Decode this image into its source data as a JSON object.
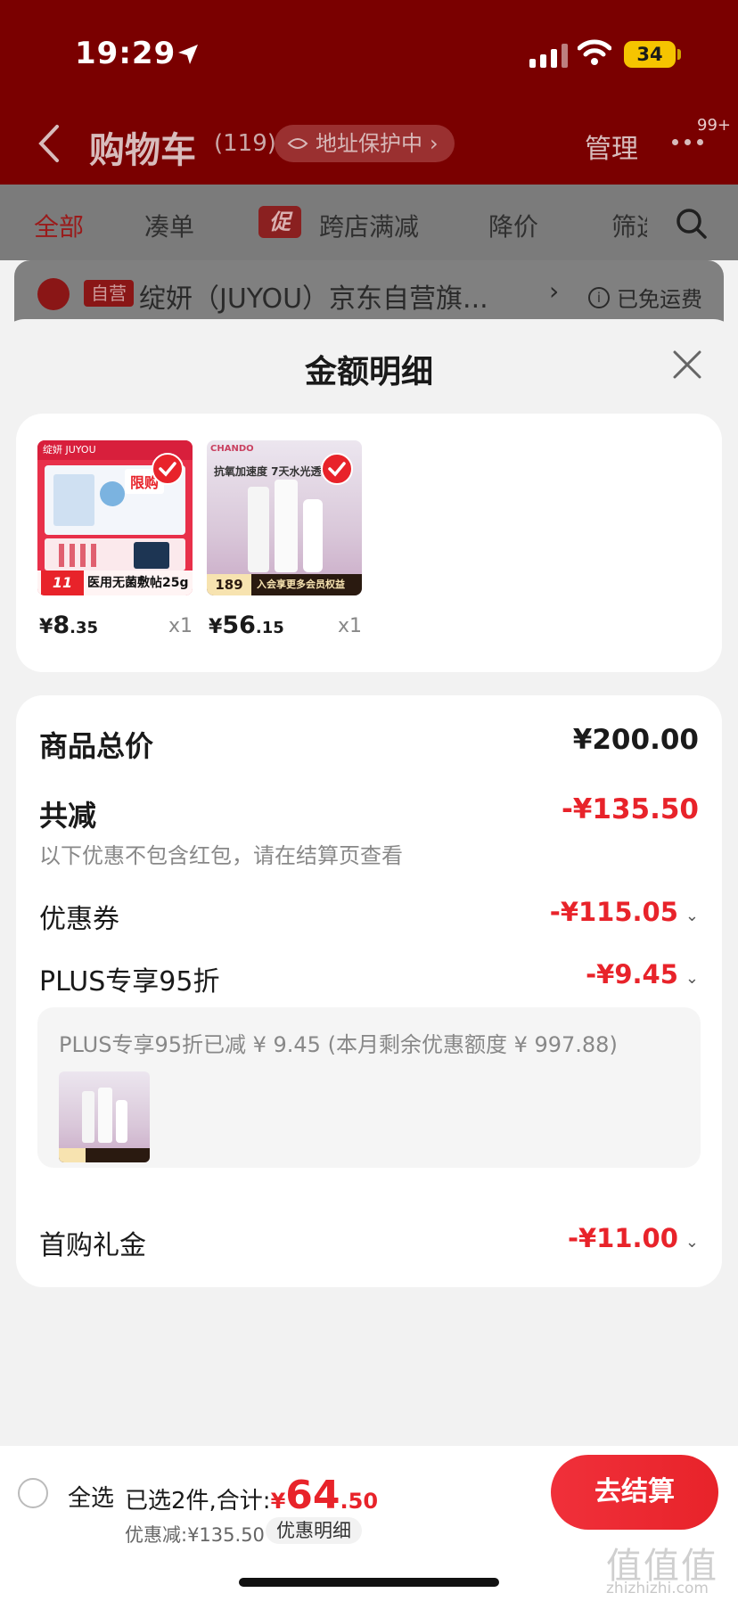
{
  "status_bar": {
    "time": "19:29",
    "battery": "34"
  },
  "header": {
    "title": "购物车",
    "count": "(119)",
    "address_chip": "地址保护中",
    "manage": "管理",
    "more_badge": "99+"
  },
  "filter_tabs": [
    "全部",
    "凑单",
    "跨店满减",
    "降价",
    "筛选"
  ],
  "promo_badge": "促",
  "shop": {
    "tag": "自营",
    "name": "绽妍（JUYOU）京东自营旗...",
    "shipping": "已免运费"
  },
  "sheet": {
    "title": "金额明细",
    "products": [
      {
        "price_yen": "¥",
        "price_int": "8",
        "price_dec": ".35",
        "qty": "x1",
        "thumb_text": "医用无菌敷帖25g",
        "thumb_brand": "绽妍 JUYOU",
        "thumb_tag": "限购",
        "thumb_num": "11"
      },
      {
        "price_yen": "¥",
        "price_int": "56",
        "price_dec": ".15",
        "qty": "x1",
        "thumb_text": "抗氧加速度 7天水光透",
        "thumb_brand": "CHANDO",
        "thumb_price": "189",
        "thumb_banner": "入会享更多会员权益"
      }
    ],
    "detail": {
      "total_label": "商品总价",
      "total_value": "¥200.00",
      "reduce_label": "共减",
      "reduce_value": "-¥135.50",
      "reduce_note": "以下优惠不包含红包，请在结算页查看",
      "coupon_label": "优惠券",
      "coupon_value": "-¥115.05",
      "plus_label": "PLUS专享95折",
      "plus_value": "-¥9.45",
      "plus_note": "PLUS专享95折已减 ¥ 9.45 (本月剩余优惠额度 ¥ 997.88)",
      "first_label": "首购礼金",
      "first_value": "-¥11.00"
    }
  },
  "bottom": {
    "select_all": "全选",
    "selected_text": "已选2件,合计:",
    "total_yen": "¥",
    "total_int": "64",
    "total_dec": ".50",
    "discount": "优惠减:¥135.50",
    "detail_btn": "优惠明细",
    "checkout": "去结算"
  },
  "watermark": {
    "main": "值值值",
    "sub": "zhizhizhi.com"
  },
  "colors": {
    "accent": "#e8232a",
    "header_bg": "#7a0000"
  }
}
